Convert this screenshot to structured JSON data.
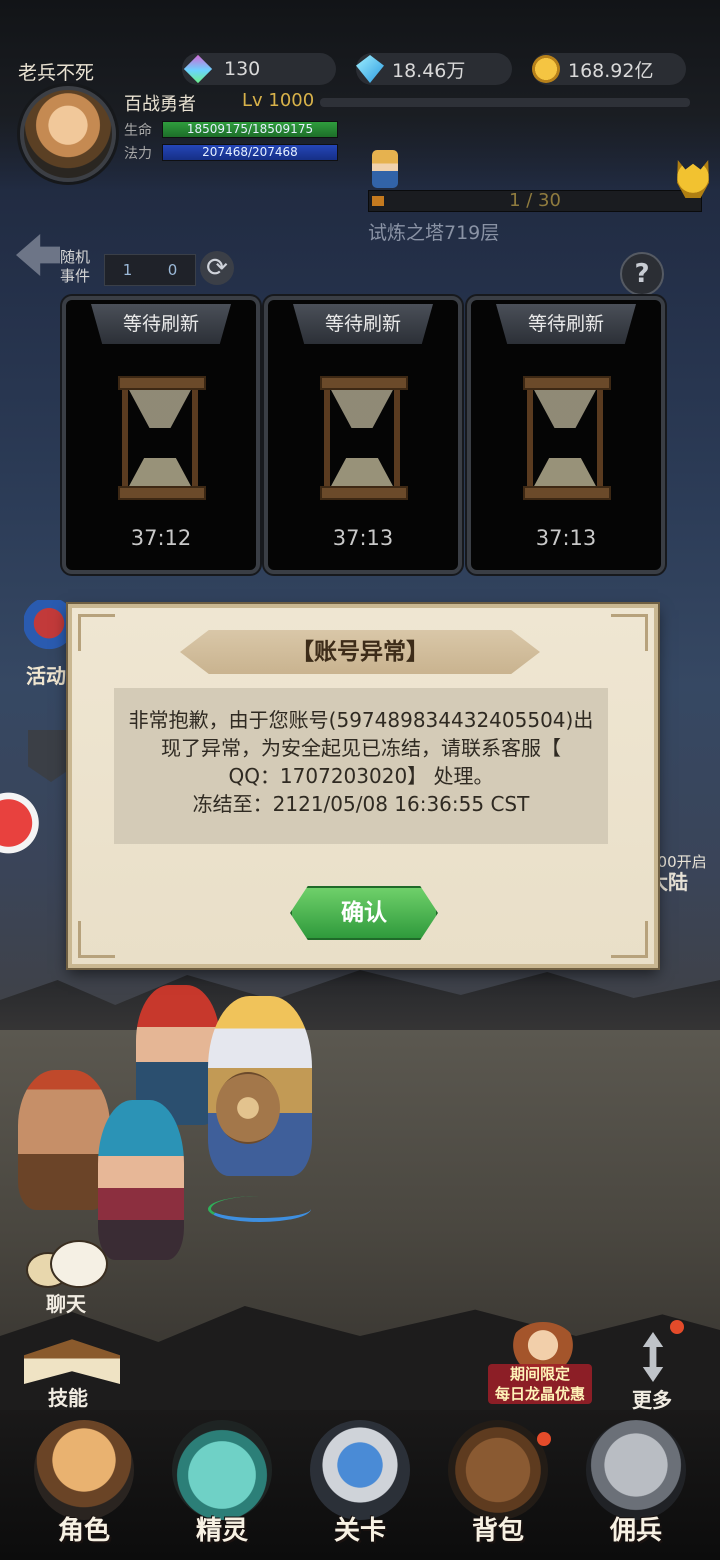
{
  "player": {
    "name": "老兵不死",
    "hero_title": "百战勇者",
    "level": "Lv 1000",
    "hp_label": "生命",
    "hp_value": "18509175/18509175",
    "mp_label": "法力",
    "mp_value": "207468/207468"
  },
  "currencies": {
    "gems": "130",
    "diamonds": "18.46万",
    "gold": "168.92亿"
  },
  "tower": {
    "progress": "1 / 30",
    "progress_fraction": 0.033,
    "label": "试炼之塔719层"
  },
  "random_event": {
    "label": "随机\n事件",
    "count_a": "1",
    "count_b": "0"
  },
  "cards": [
    {
      "banner": "等待刷新",
      "timer": "37:12"
    },
    {
      "banner": "等待刷新",
      "timer": "37:13"
    },
    {
      "banner": "等待刷新",
      "timer": "37:13"
    }
  ],
  "side": {
    "activity_label": "活动",
    "continent_unlock": "100开启",
    "continent_label": "大陆"
  },
  "dialog": {
    "title": "【账号异常】",
    "line1": "非常抱歉，由于您账号(597489834432405504)出",
    "line2": "现了异常，为安全起见已冻结，请联系客服【",
    "line3": "QQ：1707203020】 处理。",
    "line4": "冻结至：2121/05/08 16:36:55 CST",
    "confirm_label": "确认"
  },
  "quick": {
    "chat_label": "聊天",
    "skill_label": "技能",
    "promo_label": "期间限定\n每日龙晶优惠",
    "more_label": "更多"
  },
  "nav": {
    "role": "角色",
    "spirit": "精灵",
    "stage": "关卡",
    "bag": "背包",
    "merc": "佣兵"
  },
  "colors": {
    "hp_bar": "#2f9d3d",
    "mp_bar": "#2546b8",
    "level_text": "#d8b24a",
    "confirm_button": "#3fae48",
    "dialog_bg": "#efe6d2",
    "notification_dot": "#e44b2a"
  },
  "icons": {
    "gem": "gem-icon",
    "diamond": "diamond-icon",
    "gold": "gold-coin-icon",
    "refresh": "refresh-icon",
    "help": "question-icon",
    "back": "back-arrow-icon",
    "hourglass": "hourglass-icon",
    "boss": "skull-icon"
  }
}
